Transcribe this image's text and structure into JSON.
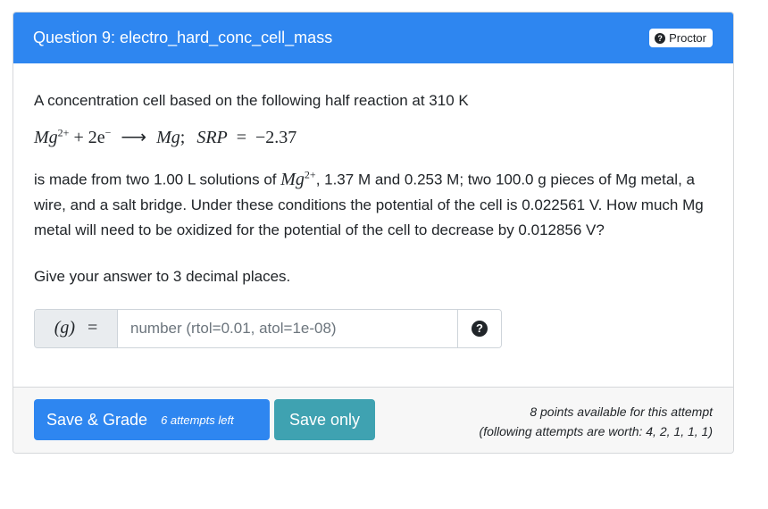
{
  "header": {
    "title": "Question 9: electro_hard_conc_cell_mass",
    "proctor_label": "Proctor"
  },
  "question": {
    "intro": "A concentration cell based on the following half reaction at 310 K",
    "equation": {
      "reactant_ion": "Mg",
      "reactant_ion_charge": "2+",
      "electrons": "2e",
      "electron_charge": "−",
      "arrow": "⟶",
      "product": "Mg",
      "separator": ";",
      "srp_label": "SRP",
      "equals": "=",
      "srp_value": "−2.37"
    },
    "body_before_ion": "is made from two 1.00 L solutions of ",
    "body_ion": "Mg",
    "body_ion_charge": "2+",
    "body_after_ion": ", 1.37 M and 0.253 M; two 100.0 g pieces of Mg metal, a wire, and a salt bridge. Under these conditions the potential of the cell is 0.022561 V. How much Mg metal will need to be oxidized for the potential of the cell to decrease by 0.012856 V?",
    "instruction": "Give your answer to 3 decimal places."
  },
  "answer": {
    "unit": "(g)",
    "equals": "=",
    "placeholder": "number (rtol=0.01, atol=1e-08)",
    "value": ""
  },
  "footer": {
    "grade_button_label": "Save & Grade",
    "attempts_left": "6 attempts left",
    "save_button_label": "Save only",
    "points_line1": "8 points available for this attempt",
    "points_line2": "(following attempts are worth: 4, 2, 1, 1, 1)"
  },
  "colors": {
    "header_bg": "#2e86f0",
    "grade_button": "#2e86f0",
    "save_button": "#3fa2b1",
    "footer_bg": "#f7f7f7"
  },
  "icons": {
    "proctor": "question-circle-icon",
    "help": "question-circle-icon"
  }
}
